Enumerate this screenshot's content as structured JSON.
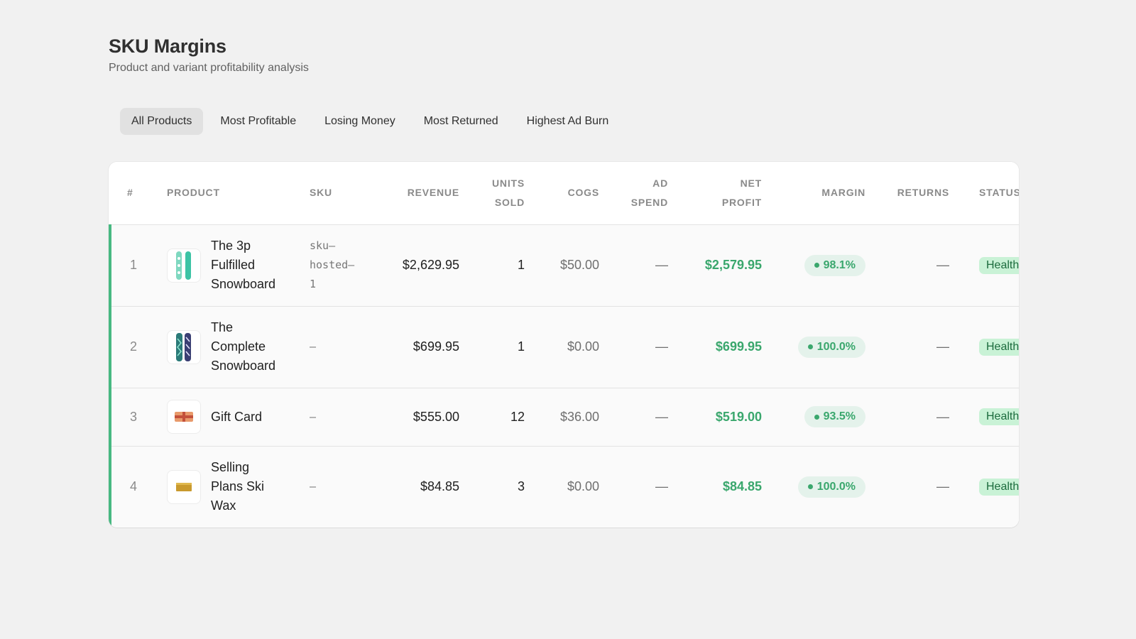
{
  "header": {
    "title": "SKU Margins",
    "subtitle": "Product and variant profitability analysis"
  },
  "tabs": [
    {
      "label": "All Products",
      "active": true
    },
    {
      "label": "Most Profitable",
      "active": false
    },
    {
      "label": "Losing Money",
      "active": false
    },
    {
      "label": "Most Returned",
      "active": false
    },
    {
      "label": "Highest Ad Burn",
      "active": false
    }
  ],
  "table": {
    "columns": {
      "index": "#",
      "product": "PRODUCT",
      "sku": "SKU",
      "revenue": "REVENUE",
      "units_sold_1": "UNITS",
      "units_sold_2": "SOLD",
      "cogs": "COGS",
      "ad_spend_1": "AD",
      "ad_spend_2": "SPEND",
      "net_profit_1": "NET",
      "net_profit_2": "PROFIT",
      "margin": "MARGIN",
      "returns": "RETURNS",
      "status": "STATUS"
    },
    "rows": [
      {
        "index": "1",
        "product_lines": [
          "The 3p",
          "Fulfilled",
          "Snowboard"
        ],
        "thumb_icon": "snowboard-teal-icon",
        "sku_lines": [
          "sku–",
          "hosted–",
          "1"
        ],
        "revenue": "$2,629.95",
        "units_sold": "1",
        "cogs": "$50.00",
        "ad_spend": "—",
        "net_profit": "$2,579.95",
        "margin": "98.1%",
        "returns": "—",
        "status": "Healthy"
      },
      {
        "index": "2",
        "product_lines": [
          "The",
          "Complete",
          "Snowboard"
        ],
        "thumb_icon": "snowboard-dark-icon",
        "sku_lines": [
          "–"
        ],
        "revenue": "$699.95",
        "units_sold": "1",
        "cogs": "$0.00",
        "ad_spend": "—",
        "net_profit": "$699.95",
        "margin": "100.0%",
        "returns": "—",
        "status": "Healthy"
      },
      {
        "index": "3",
        "product_lines": [
          "Gift Card"
        ],
        "thumb_icon": "gift-card-icon",
        "sku_lines": [
          "–"
        ],
        "revenue": "$555.00",
        "units_sold": "12",
        "cogs": "$36.00",
        "ad_spend": "—",
        "net_profit": "$519.00",
        "margin": "93.5%",
        "returns": "—",
        "status": "Healthy"
      },
      {
        "index": "4",
        "product_lines": [
          "Selling",
          "Plans Ski",
          "Wax"
        ],
        "thumb_icon": "ski-wax-icon",
        "sku_lines": [
          "–"
        ],
        "revenue": "$84.85",
        "units_sold": "3",
        "cogs": "$0.00",
        "ad_spend": "—",
        "net_profit": "$84.85",
        "margin": "100.0%",
        "returns": "—",
        "status": "Healthy"
      }
    ]
  },
  "colors": {
    "accent_green": "#3aa76d",
    "healthy_badge_bg": "#c9f2d6",
    "row_marker": "#47b881"
  }
}
